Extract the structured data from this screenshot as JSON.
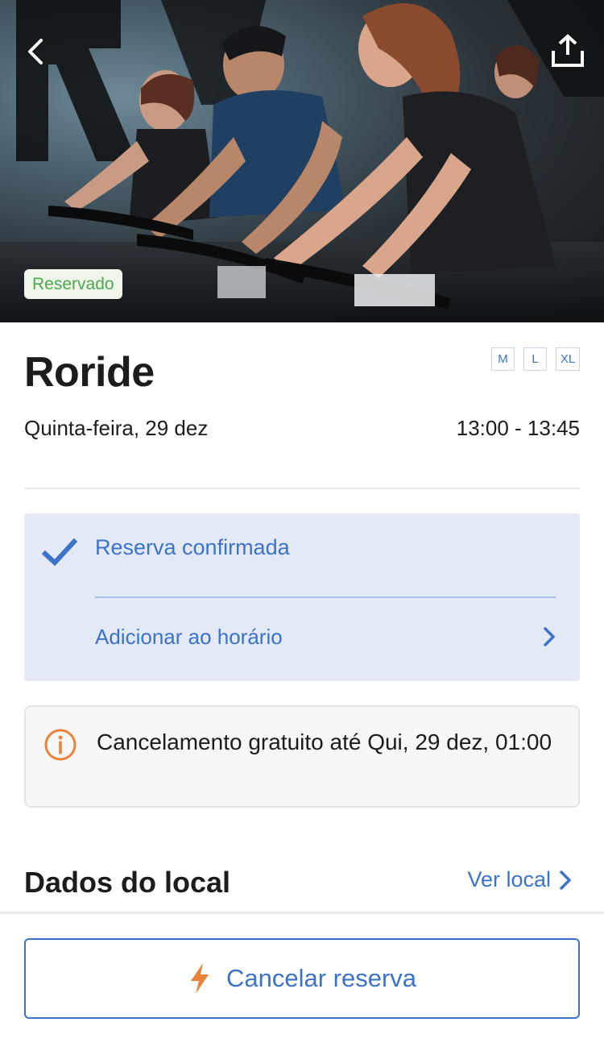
{
  "hero": {
    "status_badge": "Reservado",
    "back_icon": "chevron-left-icon",
    "share_icon": "share-upload-icon"
  },
  "class_info": {
    "title": "Roride",
    "sizes": [
      "M",
      "L",
      "XL"
    ],
    "date": "Quinta-feira, 29 dez",
    "time": "13:00 - 13:45"
  },
  "confirmation": {
    "status": "Reserva confirmada",
    "add_to_schedule": "Adicionar ao horário",
    "check_icon": "checkmark-icon"
  },
  "cancellation_notice": {
    "icon": "info-circle-icon",
    "text": "Cancelamento gratuito até Qui, 29 dez, 01:00"
  },
  "location": {
    "heading": "Dados do local",
    "link": "Ver local"
  },
  "bottom": {
    "cancel_label": "Cancelar reserva",
    "cancel_icon": "lightning-bolt-icon"
  },
  "colors": {
    "accent_blue": "#3b73c9",
    "confirm_bg": "#e3e9f7",
    "badge_green": "#4fa84c",
    "warning_orange": "#e8833a"
  }
}
